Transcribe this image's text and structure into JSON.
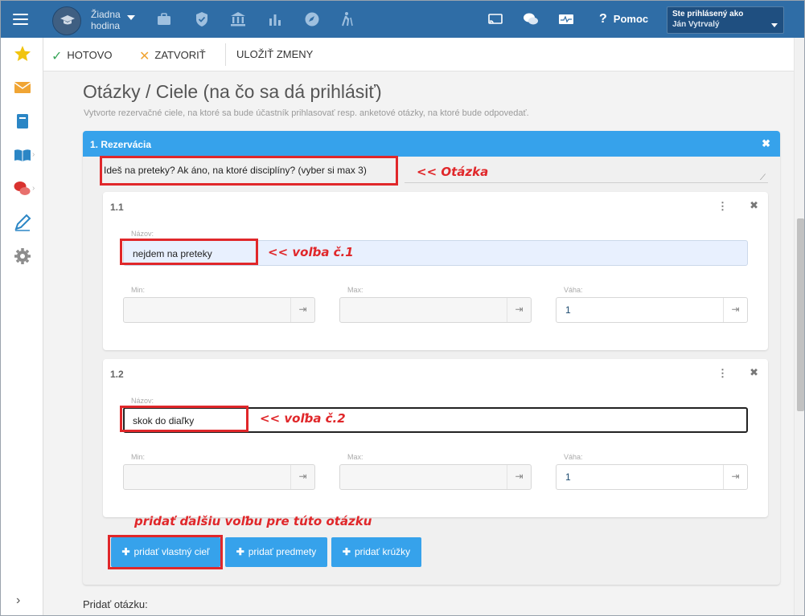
{
  "topbar": {
    "lesson_line1": "Žiadna",
    "lesson_line2": "hodina",
    "help": "Pomoc",
    "user_label": "Ste prihlásený ako",
    "user_name": "Ján Vytrvalý",
    "colors": {
      "bar": "#2f6da6",
      "user_box": "#1f4f80"
    }
  },
  "sidebar": {
    "icons": [
      "star-icon",
      "mail-icon",
      "notebook-icon",
      "book-icon",
      "chat-icon",
      "pencil-icon",
      "gear-icon"
    ],
    "collapse_glyph": "›"
  },
  "toolbar": {
    "done_label": "HOTOVO",
    "close_label": "ZATVORIŤ",
    "save_label": "ULOŽIŤ ZMENY"
  },
  "page": {
    "title": "Otázky / Ciele (na čo sa dá prihlásiť)",
    "subtitle": "Vytvorte rezervačné ciele, na ktoré sa bude účastník prihlasovať resp. anketové otázky, na ktoré bude odpovedať."
  },
  "question": {
    "header": "1.  Rezervácia",
    "text": "Ideš na preteky? Ak áno, na ktoré disciplíny? (vyber si max 3)",
    "options": [
      {
        "number": "1.1",
        "name_label": "Názov:",
        "name": "nejdem na preteky",
        "min_label": "Min:",
        "min": "",
        "max_label": "Max:",
        "max": "",
        "weight_label": "Váha:",
        "weight": "1"
      },
      {
        "number": "1.2",
        "name_label": "Názov:",
        "name": "skok do diaľky",
        "min_label": "Min:",
        "min": "",
        "max_label": "Max:",
        "max": "",
        "weight_label": "Váha:",
        "weight": "1"
      }
    ],
    "buttons": {
      "add_custom": "pridať vlastný cieľ",
      "add_subjects": "pridať predmety",
      "add_clubs": "pridať krúžky"
    }
  },
  "add_question_label": "Pridať otázku:",
  "annotations": {
    "question": "<< Otázka",
    "option1": "<< voľba č.1",
    "option2": "<< voľba č.2",
    "add_more": "pridať ďalšiu voľbu pre túto otázku",
    "color": "#e0272a"
  },
  "accent": "#36a2eb"
}
